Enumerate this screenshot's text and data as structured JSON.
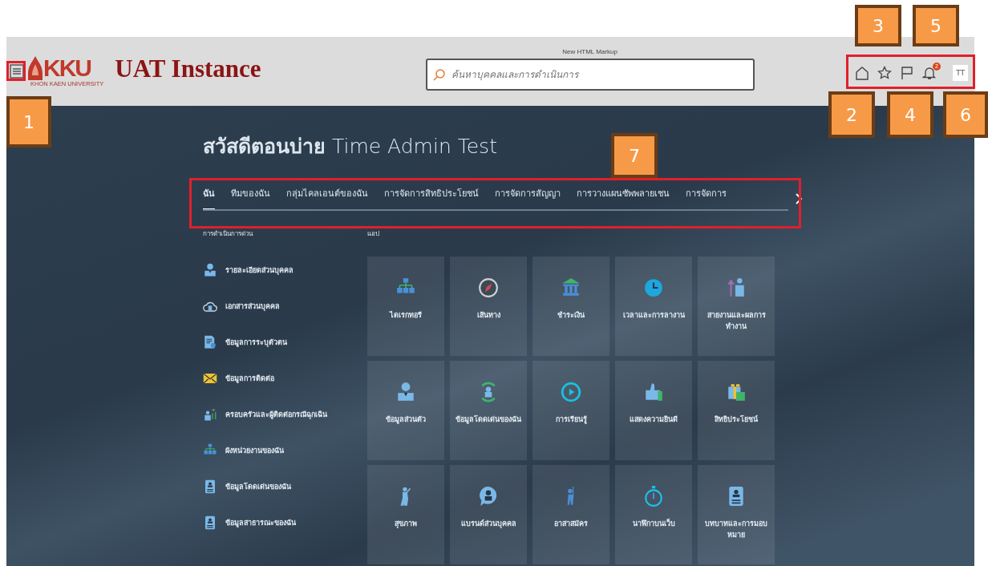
{
  "header": {
    "logo": {
      "mark": "KKU",
      "subtitle": "KHON KAEN UNIVERSITY"
    },
    "title": "UAT Instance",
    "search": {
      "caption": "New HTML Markup",
      "placeholder": "ค้นหาบุคคลและการดำเนินการ"
    },
    "notifications_badge": "2",
    "avatar": "TT"
  },
  "greeting": "**สวัสดีตอนบ่าย** Time Admin Test",
  "tabs": [
    {
      "label": "ฉัน",
      "selected": true
    },
    {
      "label": "ทีมของฉัน",
      "selected": false
    },
    {
      "label": "กลุ่มไคลเอนต์ของฉัน",
      "selected": false
    },
    {
      "label": "การจัดการสิทธิประโยชน์",
      "selected": false
    },
    {
      "label": "การจัดการสัญญา",
      "selected": false
    },
    {
      "label": "การวางแผนซัพพลายเชน",
      "selected": false
    },
    {
      "label": "การจัดการ",
      "selected": false
    }
  ],
  "quick_actions": {
    "title": "การดำเนินการด่วน",
    "items": [
      "รายละเอียดส่วนบุคคล",
      "เอกสารส่วนบุคคล",
      "ข้อมูลการระบุตัวตน",
      "ข้อมูลการติดต่อ",
      "ครอบครัวและผู้ติดต่อกรณีฉุกเฉิน",
      "ผังหน่วยงานของฉัน",
      "ข้อมูลโดดเด่นของฉัน",
      "ข้อมูลสาธารณะของฉัน"
    ]
  },
  "apps": {
    "title": "แอป",
    "items": [
      "ไดเรกทอรี",
      "เส้นทาง",
      "ชำระเงิน",
      "เวลาและการลางาน",
      "สายงานและผลการทำงาน",
      "ข้อมูลส่วนตัว",
      "ข้อมูลโดดเด่นของฉัน",
      "การเรียนรู้",
      "แสดงความยินดี",
      "สิทธิประโยชน์",
      "สุขภาพ",
      "แบรนด์ส่วนบุคคล",
      "อาสาสมัคร",
      "นาฬิกาบนเว็บ",
      "บทบาทและการมอบหมาย"
    ]
  },
  "callouts": [
    "1",
    "2",
    "3",
    "4",
    "5",
    "6",
    "7"
  ]
}
